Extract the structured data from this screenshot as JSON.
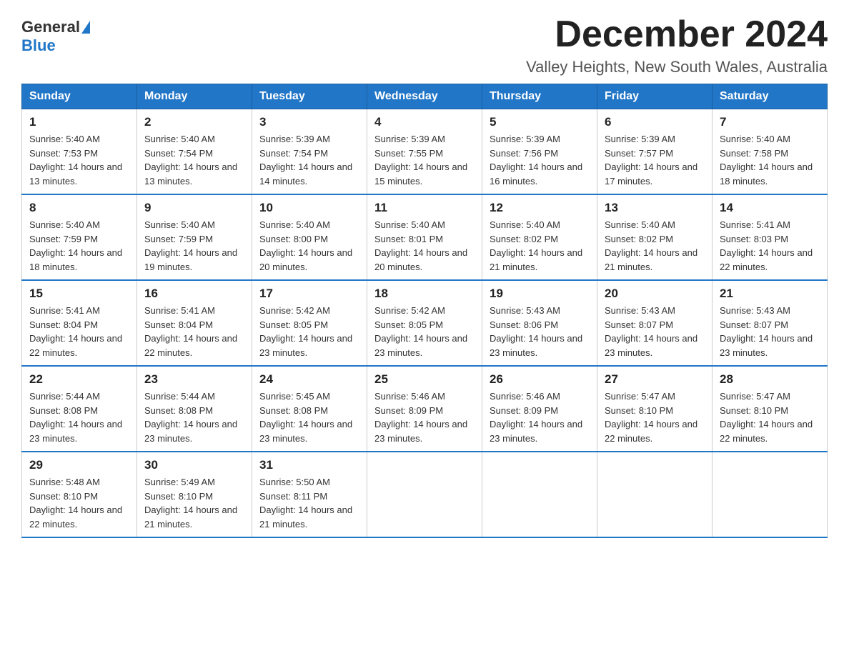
{
  "header": {
    "logo_general": "General",
    "logo_blue": "Blue",
    "month_title": "December 2024",
    "location": "Valley Heights, New South Wales, Australia"
  },
  "weekdays": [
    "Sunday",
    "Monday",
    "Tuesday",
    "Wednesday",
    "Thursday",
    "Friday",
    "Saturday"
  ],
  "weeks": [
    [
      {
        "day": "1",
        "sunrise": "5:40 AM",
        "sunset": "7:53 PM",
        "daylight": "14 hours and 13 minutes."
      },
      {
        "day": "2",
        "sunrise": "5:40 AM",
        "sunset": "7:54 PM",
        "daylight": "14 hours and 13 minutes."
      },
      {
        "day": "3",
        "sunrise": "5:39 AM",
        "sunset": "7:54 PM",
        "daylight": "14 hours and 14 minutes."
      },
      {
        "day": "4",
        "sunrise": "5:39 AM",
        "sunset": "7:55 PM",
        "daylight": "14 hours and 15 minutes."
      },
      {
        "day": "5",
        "sunrise": "5:39 AM",
        "sunset": "7:56 PM",
        "daylight": "14 hours and 16 minutes."
      },
      {
        "day": "6",
        "sunrise": "5:39 AM",
        "sunset": "7:57 PM",
        "daylight": "14 hours and 17 minutes."
      },
      {
        "day": "7",
        "sunrise": "5:40 AM",
        "sunset": "7:58 PM",
        "daylight": "14 hours and 18 minutes."
      }
    ],
    [
      {
        "day": "8",
        "sunrise": "5:40 AM",
        "sunset": "7:59 PM",
        "daylight": "14 hours and 18 minutes."
      },
      {
        "day": "9",
        "sunrise": "5:40 AM",
        "sunset": "7:59 PM",
        "daylight": "14 hours and 19 minutes."
      },
      {
        "day": "10",
        "sunrise": "5:40 AM",
        "sunset": "8:00 PM",
        "daylight": "14 hours and 20 minutes."
      },
      {
        "day": "11",
        "sunrise": "5:40 AM",
        "sunset": "8:01 PM",
        "daylight": "14 hours and 20 minutes."
      },
      {
        "day": "12",
        "sunrise": "5:40 AM",
        "sunset": "8:02 PM",
        "daylight": "14 hours and 21 minutes."
      },
      {
        "day": "13",
        "sunrise": "5:40 AM",
        "sunset": "8:02 PM",
        "daylight": "14 hours and 21 minutes."
      },
      {
        "day": "14",
        "sunrise": "5:41 AM",
        "sunset": "8:03 PM",
        "daylight": "14 hours and 22 minutes."
      }
    ],
    [
      {
        "day": "15",
        "sunrise": "5:41 AM",
        "sunset": "8:04 PM",
        "daylight": "14 hours and 22 minutes."
      },
      {
        "day": "16",
        "sunrise": "5:41 AM",
        "sunset": "8:04 PM",
        "daylight": "14 hours and 22 minutes."
      },
      {
        "day": "17",
        "sunrise": "5:42 AM",
        "sunset": "8:05 PM",
        "daylight": "14 hours and 23 minutes."
      },
      {
        "day": "18",
        "sunrise": "5:42 AM",
        "sunset": "8:05 PM",
        "daylight": "14 hours and 23 minutes."
      },
      {
        "day": "19",
        "sunrise": "5:43 AM",
        "sunset": "8:06 PM",
        "daylight": "14 hours and 23 minutes."
      },
      {
        "day": "20",
        "sunrise": "5:43 AM",
        "sunset": "8:07 PM",
        "daylight": "14 hours and 23 minutes."
      },
      {
        "day": "21",
        "sunrise": "5:43 AM",
        "sunset": "8:07 PM",
        "daylight": "14 hours and 23 minutes."
      }
    ],
    [
      {
        "day": "22",
        "sunrise": "5:44 AM",
        "sunset": "8:08 PM",
        "daylight": "14 hours and 23 minutes."
      },
      {
        "day": "23",
        "sunrise": "5:44 AM",
        "sunset": "8:08 PM",
        "daylight": "14 hours and 23 minutes."
      },
      {
        "day": "24",
        "sunrise": "5:45 AM",
        "sunset": "8:08 PM",
        "daylight": "14 hours and 23 minutes."
      },
      {
        "day": "25",
        "sunrise": "5:46 AM",
        "sunset": "8:09 PM",
        "daylight": "14 hours and 23 minutes."
      },
      {
        "day": "26",
        "sunrise": "5:46 AM",
        "sunset": "8:09 PM",
        "daylight": "14 hours and 23 minutes."
      },
      {
        "day": "27",
        "sunrise": "5:47 AM",
        "sunset": "8:10 PM",
        "daylight": "14 hours and 22 minutes."
      },
      {
        "day": "28",
        "sunrise": "5:47 AM",
        "sunset": "8:10 PM",
        "daylight": "14 hours and 22 minutes."
      }
    ],
    [
      {
        "day": "29",
        "sunrise": "5:48 AM",
        "sunset": "8:10 PM",
        "daylight": "14 hours and 22 minutes."
      },
      {
        "day": "30",
        "sunrise": "5:49 AM",
        "sunset": "8:10 PM",
        "daylight": "14 hours and 21 minutes."
      },
      {
        "day": "31",
        "sunrise": "5:50 AM",
        "sunset": "8:11 PM",
        "daylight": "14 hours and 21 minutes."
      },
      null,
      null,
      null,
      null
    ]
  ]
}
